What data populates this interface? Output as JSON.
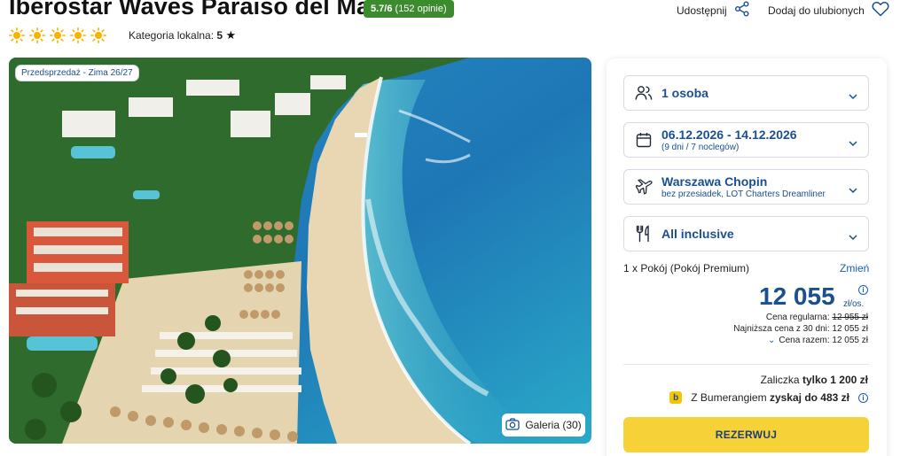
{
  "hotel": {
    "name": "Iberostar Waves Paraiso del Mar",
    "rating_score": "5.7/6",
    "rating_count": "(152 opinie)",
    "sun_count": 5,
    "category_label": "Kategoria lokalna:",
    "category_value": "5"
  },
  "actions": {
    "share_label": "Udostępnij",
    "favorite_label": "Dodaj do ulubionych"
  },
  "photo": {
    "presale_badge": "Przedsprzedaż - Zima 26/27",
    "gallery_label": "Galeria (30)"
  },
  "booking": {
    "travelers": "1 osoba",
    "dates": "06.12.2026 - 14.12.2026",
    "dates_sub": "(9 dni / 7 noclegów)",
    "airport": "Warszawa Chopin",
    "airport_sub": "bez przesiadek, LOT Charters Dreamliner",
    "board": "All inclusive",
    "room": "1 x Pokój  (Pokój Premium)",
    "change_label": "Zmień",
    "price": "12 055",
    "price_unit": "zł/os.",
    "regular_price_label": "Cena regularna:",
    "regular_price": "12 955 zł",
    "lowest_30_label": "Najniższa cena z 30 dni: 12 055 zł",
    "total_label": "Cena razem: 12 055 zł",
    "deposit_label": "Zaliczka",
    "deposit_value": "tylko 1 200 zł",
    "boomerang_label": "Z Bumerangiem",
    "boomerang_value": "zyskaj do 483 zł",
    "reserve_label": "REZERWUJ"
  },
  "colors": {
    "brand_blue": "#1a4f91",
    "rating_green": "#3d8b2f",
    "reserve_yellow": "#f7d138",
    "sun_yellow": "#f5b400"
  }
}
